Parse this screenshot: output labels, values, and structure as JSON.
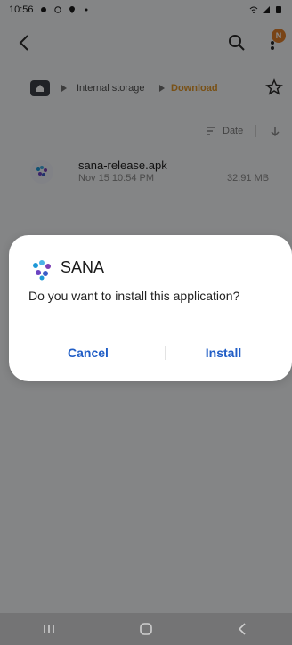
{
  "status_bar": {
    "time": "10:56"
  },
  "top_bar": {
    "notification_badge": "N"
  },
  "breadcrumb": {
    "internal": "Internal storage",
    "download": "Download"
  },
  "sort": {
    "label": "Date"
  },
  "file": {
    "name": "sana-release.apk",
    "date": "Nov 15 10:54 PM",
    "size": "32.91 MB"
  },
  "dialog": {
    "app_name": "SANA",
    "message": "Do you want to install this application?",
    "cancel_label": "Cancel",
    "install_label": "Install"
  },
  "colors": {
    "accent_blue": "#215ec6",
    "folder_orange": "#e0962a",
    "badge_orange": "#e07f2a"
  },
  "icons": [
    "back-icon",
    "search-icon",
    "more-vertical-icon",
    "home-icon",
    "chevron-right-icon",
    "star-icon",
    "sort-icon",
    "arrow-down-icon",
    "app-icon",
    "recents-icon",
    "home-nav-icon",
    "back-nav-icon"
  ]
}
